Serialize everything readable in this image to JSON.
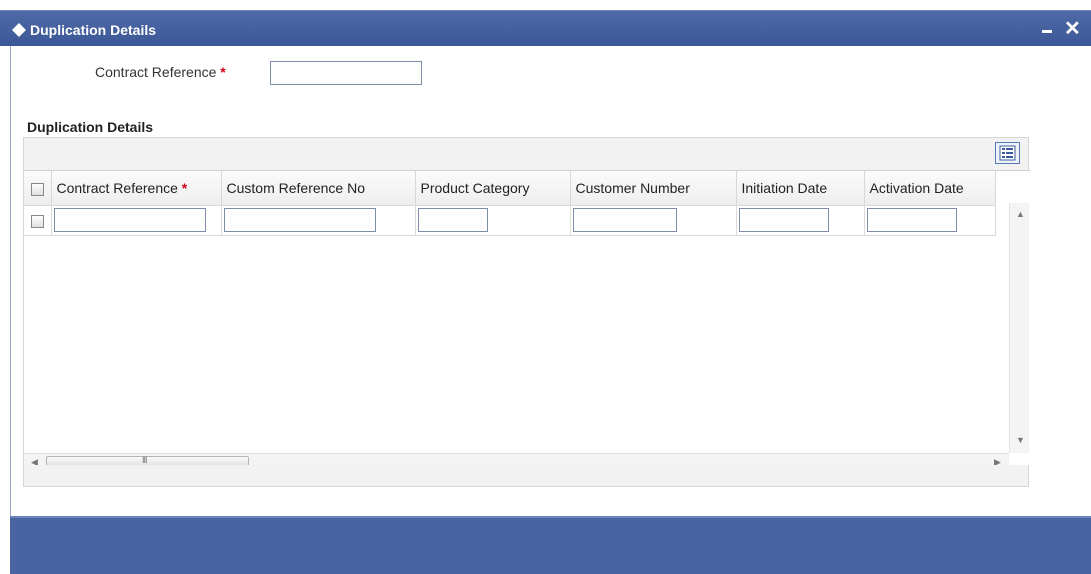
{
  "window": {
    "title": "Duplication Details",
    "minimize_icon": "minimize-icon",
    "close_icon": "close-icon",
    "close_glyph": "✕"
  },
  "form": {
    "contract_reference_label": "Contract Reference",
    "required_marker": "*",
    "contract_reference_value": ""
  },
  "section": {
    "title": "Duplication Details"
  },
  "grid": {
    "columns": [
      {
        "label": "Contract Reference",
        "required": true
      },
      {
        "label": "Custom Reference No",
        "required": false
      },
      {
        "label": "Product Category",
        "required": false
      },
      {
        "label": "Customer Number",
        "required": false
      },
      {
        "label": "Initiation Date",
        "required": false
      },
      {
        "label": "Activation Date",
        "required": false
      }
    ],
    "rows": [
      [
        "",
        "",
        "",
        "",
        "",
        ""
      ]
    ],
    "scroll_glyph": "III"
  },
  "colors": {
    "titlebar": "#3c5797",
    "footer": "#4a64a1",
    "required": "#d0021b"
  }
}
